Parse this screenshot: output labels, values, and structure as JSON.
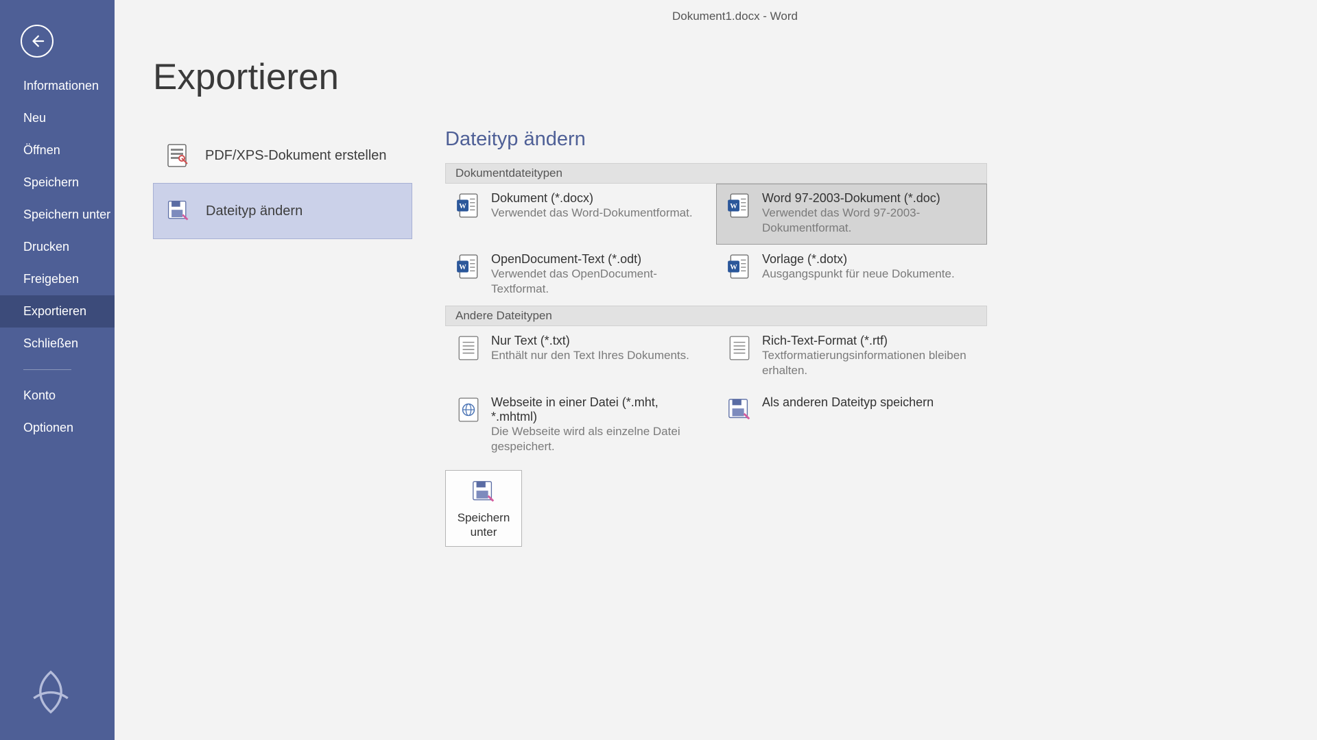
{
  "window_title": "Dokument1.docx - Word",
  "page_title": "Exportieren",
  "sidebar": {
    "items": [
      "Informationen",
      "Neu",
      "Öffnen",
      "Speichern",
      "Speichern unter",
      "Drucken",
      "Freigeben",
      "Exportieren",
      "Schließen"
    ],
    "active_index": 7,
    "footer_items": [
      "Konto",
      "Optionen"
    ]
  },
  "export_options": {
    "items": [
      {
        "label": "PDF/XPS-Dokument erstellen",
        "icon": "page-pdf"
      },
      {
        "label": "Dateityp ändern",
        "icon": "save-arrow"
      }
    ],
    "selected_index": 1
  },
  "detail": {
    "title": "Dateityp ändern",
    "groups": [
      {
        "header": "Dokumentdateitypen",
        "tiles": [
          {
            "icon": "word-doc",
            "title": "Dokument (*.docx)",
            "desc": "Verwendet das Word-Dokumentformat.",
            "selected": false
          },
          {
            "icon": "word-doc",
            "title": "Word 97-2003-Dokument (*.doc)",
            "desc": "Verwendet das Word 97-2003-Dokumentformat.",
            "selected": true
          },
          {
            "icon": "word-doc",
            "title": "OpenDocument-Text (*.odt)",
            "desc": "Verwendet das OpenDocument-Textformat.",
            "selected": false
          },
          {
            "icon": "word-doc",
            "title": "Vorlage (*.dotx)",
            "desc": "Ausgangspunkt für neue Dokumente.",
            "selected": false
          }
        ]
      },
      {
        "header": "Andere Dateitypen",
        "tiles": [
          {
            "icon": "text-doc",
            "title": "Nur Text (*.txt)",
            "desc": "Enthält nur den Text Ihres Dokuments.",
            "selected": false
          },
          {
            "icon": "text-doc",
            "title": "Rich-Text-Format (*.rtf)",
            "desc": "Textformatierungsinformationen bleiben erhalten.",
            "selected": false
          },
          {
            "icon": "web-doc",
            "title": "Webseite in einer Datei (*.mht, *.mhtml)",
            "desc": "Die Webseite wird als einzelne Datei gespeichert.",
            "selected": false
          },
          {
            "icon": "save-arrow",
            "title": "Als anderen Dateityp speichern",
            "desc": "",
            "selected": false
          }
        ]
      }
    ],
    "save_as_button": "Speichern unter"
  }
}
